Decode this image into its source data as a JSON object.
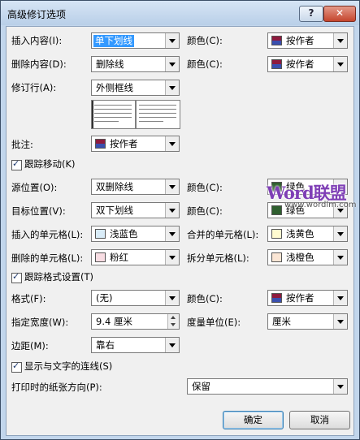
{
  "window": {
    "title": "高级修订选项",
    "help_button": "?",
    "close_button": "✕"
  },
  "markup": {
    "insertions_label": "插入内容(I):",
    "insertions_value": "单下划线",
    "insertions_color_label": "颜色(C):",
    "insertions_color_value": "按作者",
    "deletions_label": "删除内容(D):",
    "deletions_value": "删除线",
    "deletions_color_label": "颜色(C):",
    "deletions_color_value": "按作者",
    "changed_lines_label": "修订行(A):",
    "changed_lines_value": "外侧框线",
    "comments_label": "批注:",
    "comments_value": "按作者"
  },
  "moves": {
    "track_moves_label": "跟踪移动(K)",
    "moved_from_label": "源位置(O):",
    "moved_from_value": "双删除线",
    "moved_from_color_label": "颜色(C):",
    "moved_from_color_value": "绿色",
    "moved_to_label": "目标位置(V):",
    "moved_to_value": "双下划线",
    "moved_to_color_label": "颜色(C):",
    "moved_to_color_value": "绿色"
  },
  "table_cells": {
    "inserted_label": "插入的单元格(L):",
    "inserted_value": "浅蓝色",
    "merged_label": "合并的单元格(L):",
    "merged_value": "浅黄色",
    "deleted_label": "删除的单元格(L):",
    "deleted_value": "粉红",
    "split_label": "拆分单元格(L):",
    "split_value": "浅橙色"
  },
  "formatting": {
    "track_formatting_label": "跟踪格式设置(T)",
    "format_label": "格式(F):",
    "format_value": "(无)",
    "format_color_label": "颜色(C):",
    "format_color_value": "按作者"
  },
  "balloons": {
    "width_label": "指定宽度(W):",
    "width_value": "9.4 厘米",
    "measure_label": "度量单位(E):",
    "measure_value": "厘米",
    "margin_label": "边距(M):",
    "margin_value": "靠右",
    "show_lines_label": "显示与文字的连线(S)",
    "paper_orientation_label": "打印时的纸张方向(P):",
    "paper_orientation_value": "保留"
  },
  "buttons": {
    "ok": "确定",
    "cancel": "取消"
  },
  "watermark": {
    "text": "Word联盟",
    "url": "www.wordlm.com"
  },
  "colors": {
    "author_top": "#8e1b3e",
    "author_bottom": "#3a4fae",
    "green": "#2f5f2f",
    "light_blue": "#d9ecf8",
    "light_yellow": "#fffbd0",
    "pink": "#f8dde3",
    "light_orange": "#fbe6d5",
    "selection": "#3399ff"
  }
}
